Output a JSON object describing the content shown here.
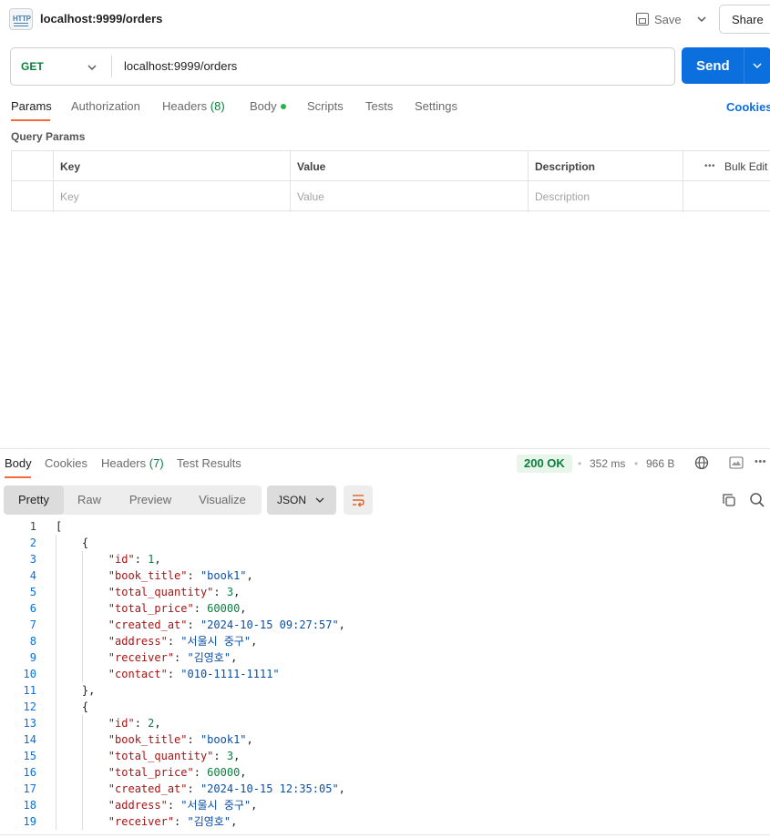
{
  "header": {
    "http_badge": "HTTP",
    "request_title": "localhost:9999/orders",
    "save_label": "Save",
    "share_label": "Share"
  },
  "request": {
    "method": "GET",
    "url": "localhost:9999/orders",
    "send_label": "Send"
  },
  "request_tabs": {
    "params": "Params",
    "authorization": "Authorization",
    "headers": "Headers",
    "headers_count": "(8)",
    "body": "Body",
    "scripts": "Scripts",
    "tests": "Tests",
    "settings": "Settings",
    "cookies": "Cookies"
  },
  "query_params": {
    "label": "Query Params",
    "headers": {
      "key": "Key",
      "value": "Value",
      "description": "Description"
    },
    "placeholders": {
      "key": "Key",
      "value": "Value",
      "description": "Description"
    },
    "bulk_edit": "Bulk Edit"
  },
  "response": {
    "tabs": {
      "body": "Body",
      "cookies": "Cookies",
      "headers": "Headers",
      "headers_count": "(7)",
      "test_results": "Test Results"
    },
    "status": "200 OK",
    "time": "352 ms",
    "size": "966 B",
    "formats": [
      "Pretty",
      "Raw",
      "Preview",
      "Visualize"
    ],
    "language": "JSON",
    "lines": [
      [
        [
          "p",
          "["
        ]
      ],
      [
        [
          "p",
          "    {"
        ]
      ],
      [
        [
          "p",
          "        "
        ],
        [
          "k",
          "\"id\""
        ],
        [
          "p",
          ": "
        ],
        [
          "n",
          "1"
        ],
        [
          "p",
          ","
        ]
      ],
      [
        [
          "p",
          "        "
        ],
        [
          "k",
          "\"book_title\""
        ],
        [
          "p",
          ": "
        ],
        [
          "s",
          "\"book1\""
        ],
        [
          "p",
          ","
        ]
      ],
      [
        [
          "p",
          "        "
        ],
        [
          "k",
          "\"total_quantity\""
        ],
        [
          "p",
          ": "
        ],
        [
          "n",
          "3"
        ],
        [
          "p",
          ","
        ]
      ],
      [
        [
          "p",
          "        "
        ],
        [
          "k",
          "\"total_price\""
        ],
        [
          "p",
          ": "
        ],
        [
          "n",
          "60000"
        ],
        [
          "p",
          ","
        ]
      ],
      [
        [
          "p",
          "        "
        ],
        [
          "k",
          "\"created_at\""
        ],
        [
          "p",
          ": "
        ],
        [
          "s",
          "\"2024-10-15 09:27:57\""
        ],
        [
          "p",
          ","
        ]
      ],
      [
        [
          "p",
          "        "
        ],
        [
          "k",
          "\"address\""
        ],
        [
          "p",
          ": "
        ],
        [
          "s",
          "\"서울시 중구\""
        ],
        [
          "p",
          ","
        ]
      ],
      [
        [
          "p",
          "        "
        ],
        [
          "k",
          "\"receiver\""
        ],
        [
          "p",
          ": "
        ],
        [
          "s",
          "\"김영호\""
        ],
        [
          "p",
          ","
        ]
      ],
      [
        [
          "p",
          "        "
        ],
        [
          "k",
          "\"contact\""
        ],
        [
          "p",
          ": "
        ],
        [
          "s",
          "\"010-1111-1111\""
        ]
      ],
      [
        [
          "p",
          "    },"
        ]
      ],
      [
        [
          "p",
          "    {"
        ]
      ],
      [
        [
          "p",
          "        "
        ],
        [
          "k",
          "\"id\""
        ],
        [
          "p",
          ": "
        ],
        [
          "n",
          "2"
        ],
        [
          "p",
          ","
        ]
      ],
      [
        [
          "p",
          "        "
        ],
        [
          "k",
          "\"book_title\""
        ],
        [
          "p",
          ": "
        ],
        [
          "s",
          "\"book1\""
        ],
        [
          "p",
          ","
        ]
      ],
      [
        [
          "p",
          "        "
        ],
        [
          "k",
          "\"total_quantity\""
        ],
        [
          "p",
          ": "
        ],
        [
          "n",
          "3"
        ],
        [
          "p",
          ","
        ]
      ],
      [
        [
          "p",
          "        "
        ],
        [
          "k",
          "\"total_price\""
        ],
        [
          "p",
          ": "
        ],
        [
          "n",
          "60000"
        ],
        [
          "p",
          ","
        ]
      ],
      [
        [
          "p",
          "        "
        ],
        [
          "k",
          "\"created_at\""
        ],
        [
          "p",
          ": "
        ],
        [
          "s",
          "\"2024-10-15 12:35:05\""
        ],
        [
          "p",
          ","
        ]
      ],
      [
        [
          "p",
          "        "
        ],
        [
          "k",
          "\"address\""
        ],
        [
          "p",
          ": "
        ],
        [
          "s",
          "\"서울시 중구\""
        ],
        [
          "p",
          ","
        ]
      ],
      [
        [
          "p",
          "        "
        ],
        [
          "k",
          "\"receiver\""
        ],
        [
          "p",
          ": "
        ],
        [
          "s",
          "\"김영호\""
        ],
        [
          "p",
          ","
        ]
      ]
    ]
  },
  "colors": {
    "accent": "#0b6fde",
    "active_tab": "#f26b3a",
    "success": "#0a7f3f"
  },
  "icons": [
    "http-file-icon",
    "save-icon",
    "chevron-down-icon",
    "globe-icon",
    "image-icon",
    "more-icon",
    "wrap-lines-icon",
    "copy-icon",
    "search-icon"
  ]
}
